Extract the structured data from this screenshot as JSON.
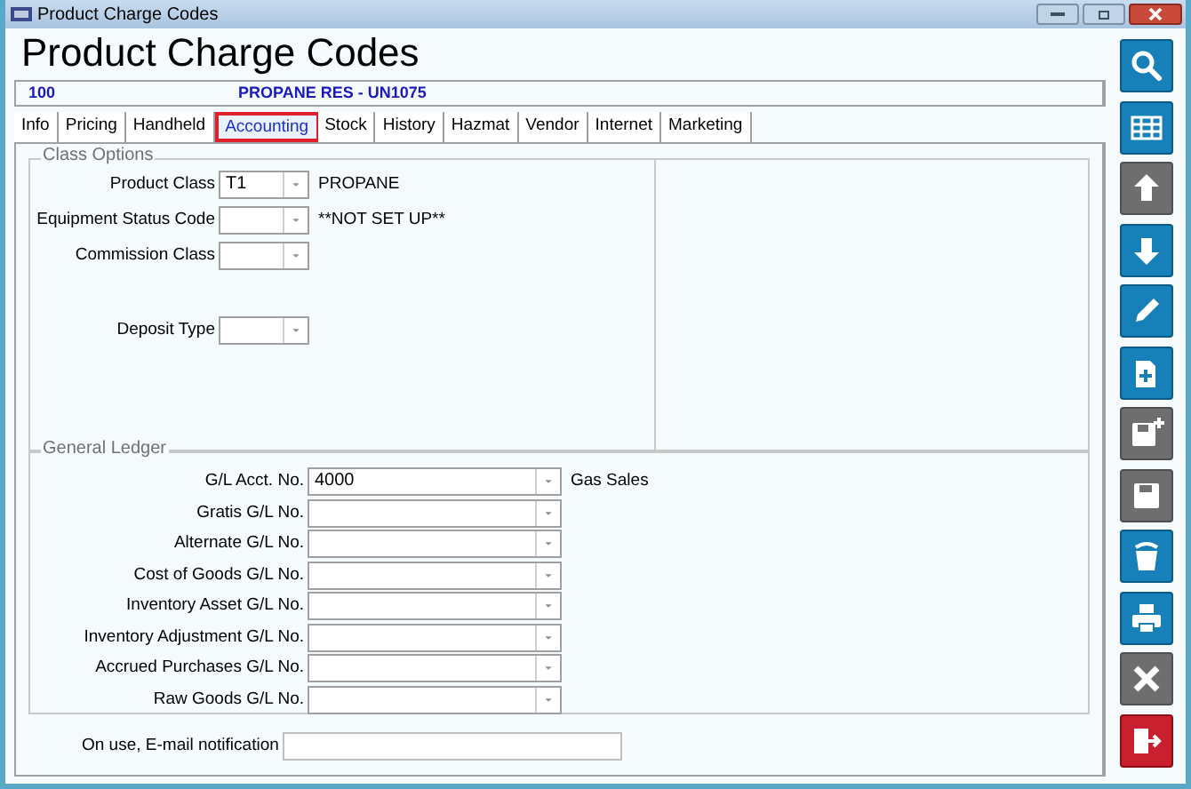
{
  "window": {
    "title": "Product Charge Codes"
  },
  "heading": "Product Charge Codes",
  "record": {
    "code": "100",
    "description": "PROPANE RES - UN1075"
  },
  "tabs": [
    {
      "label": "Info",
      "selected": false
    },
    {
      "label": "Pricing",
      "selected": false
    },
    {
      "label": "Handheld",
      "selected": false
    },
    {
      "label": "Accounting",
      "selected": true
    },
    {
      "label": "Stock",
      "selected": false
    },
    {
      "label": "History",
      "selected": false
    },
    {
      "label": "Hazmat",
      "selected": false
    },
    {
      "label": "Vendor",
      "selected": false
    },
    {
      "label": "Internet",
      "selected": false
    },
    {
      "label": "Marketing",
      "selected": false
    }
  ],
  "class_options": {
    "title": "Class Options",
    "fields": [
      {
        "label": "Product Class",
        "value": "T1",
        "note": "PROPANE"
      },
      {
        "label": "Equipment Status Code",
        "note": "**NOT SET UP**"
      },
      {
        "label": "Commission Class"
      },
      {
        "label": "Deposit Type"
      }
    ]
  },
  "general_ledger": {
    "title": "General Ledger",
    "fields": [
      {
        "label": "G/L Acct. No.",
        "value": "4000",
        "note": "Gas Sales"
      },
      {
        "label": "Gratis G/L No."
      },
      {
        "label": "Alternate G/L No."
      },
      {
        "label": "Cost of Goods G/L No."
      },
      {
        "label": "Inventory Asset G/L No."
      },
      {
        "label": "Inventory Adjustment G/L No."
      },
      {
        "label": "Accrued Purchases G/L No."
      },
      {
        "label": "Raw Goods G/L No."
      }
    ]
  },
  "email_notification": {
    "label": "On use, E-mail notification"
  },
  "toolbar": [
    {
      "kind": "search",
      "disabled": false
    },
    {
      "kind": "grid",
      "disabled": false
    },
    {
      "kind": "up",
      "disabled": true
    },
    {
      "kind": "down",
      "disabled": false
    },
    {
      "kind": "edit",
      "disabled": false
    },
    {
      "kind": "new",
      "disabled": false
    },
    {
      "kind": "save-new",
      "disabled": true
    },
    {
      "kind": "save",
      "disabled": true
    },
    {
      "kind": "delete",
      "disabled": false
    },
    {
      "kind": "print",
      "disabled": false
    },
    {
      "kind": "cancel",
      "disabled": true
    },
    {
      "kind": "exit",
      "disabled": false
    }
  ]
}
